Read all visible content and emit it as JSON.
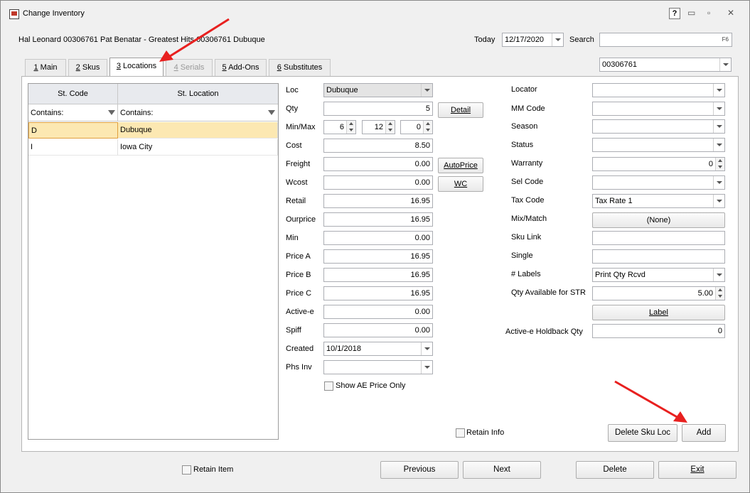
{
  "window": {
    "title": "Change Inventory",
    "help": "?",
    "minimize": "▭",
    "restore": "▫",
    "close": "✕"
  },
  "header": {
    "item_desc": "Hal Leonard 00306761 Pat Benatar - Greatest Hits 00306761 Dubuque",
    "today_label": "Today",
    "today_value": "12/17/2020",
    "search_label": "Search",
    "search_value": "",
    "search_hint": "F6"
  },
  "sku_select": "00306761",
  "tabs": [
    {
      "num": "1",
      "label": "Main"
    },
    {
      "num": "2",
      "label": "Skus"
    },
    {
      "num": "3",
      "label": "Locations"
    },
    {
      "num": "4",
      "label": "Serials"
    },
    {
      "num": "5",
      "label": "Add-Ons"
    },
    {
      "num": "6",
      "label": "Substitutes"
    }
  ],
  "grid": {
    "columns": [
      "St. Code",
      "St. Location"
    ],
    "filters": [
      "Contains:",
      "Contains:"
    ],
    "rows": [
      {
        "code": "D",
        "location": "Dubuque"
      },
      {
        "code": "I",
        "location": "Iowa City"
      }
    ]
  },
  "left_form": {
    "loc": {
      "label": "Loc",
      "value": "Dubuque"
    },
    "qty": {
      "label": "Qty",
      "value": "5"
    },
    "minmax": {
      "label": "Min/Max",
      "min": "6",
      "max": "12",
      "third": "0"
    },
    "cost": {
      "label": "Cost",
      "value": "8.50"
    },
    "freight": {
      "label": "Freight",
      "value": "0.00"
    },
    "wcost": {
      "label": "Wcost",
      "value": "0.00"
    },
    "retail": {
      "label": "Retail",
      "value": "16.95"
    },
    "ourprice": {
      "label": "Ourprice",
      "value": "16.95"
    },
    "min": {
      "label": "Min",
      "value": "0.00"
    },
    "price_a": {
      "label": "Price A",
      "value": "16.95"
    },
    "price_b": {
      "label": "Price B",
      "value": "16.95"
    },
    "price_c": {
      "label": "Price C",
      "value": "16.95"
    },
    "active_e": {
      "label": "Active-e",
      "value": "0.00"
    },
    "spiff": {
      "label": "Spiff",
      "value": "0.00"
    },
    "created": {
      "label": "Created",
      "value": "10/1/2018"
    },
    "phs_inv": {
      "label": "Phs Inv",
      "value": ""
    },
    "show_ae": "Show AE Price Only"
  },
  "mid_buttons": {
    "detail": "Detail",
    "autoprice": "AutoPrice",
    "wc": "WC"
  },
  "right_form": {
    "locator": {
      "label": "Locator",
      "value": ""
    },
    "mm_code": {
      "label": "MM Code",
      "value": ""
    },
    "season": {
      "label": "Season",
      "value": ""
    },
    "status": {
      "label": "Status",
      "value": ""
    },
    "warranty": {
      "label": "Warranty",
      "value": "0"
    },
    "sel_code": {
      "label": "Sel Code",
      "value": ""
    },
    "tax_code": {
      "label": "Tax Code",
      "value": "Tax Rate 1"
    },
    "mix_match": {
      "label": "Mix/Match",
      "value": "(None)"
    },
    "sku_link": {
      "label": "Sku Link",
      "value": ""
    },
    "single": {
      "label": "Single",
      "value": ""
    },
    "labels": {
      "label": "# Labels",
      "value": "Print Qty Rcvd"
    },
    "qty_avail_str": {
      "label": "Qty Available for STR",
      "value": "5.00"
    },
    "label_btn": "Label",
    "holdback": {
      "label": "Active-e Holdback Qty",
      "value": "0"
    }
  },
  "panel_bottom": {
    "retain_info": "Retain Info",
    "delete_sku_loc": "Delete Sku Loc",
    "add": "Add"
  },
  "footer": {
    "retain_item": "Retain Item",
    "previous": "Previous",
    "next": "Next",
    "delete": "Delete",
    "exit": "Exit"
  },
  "annotation_color": "#e8201f"
}
